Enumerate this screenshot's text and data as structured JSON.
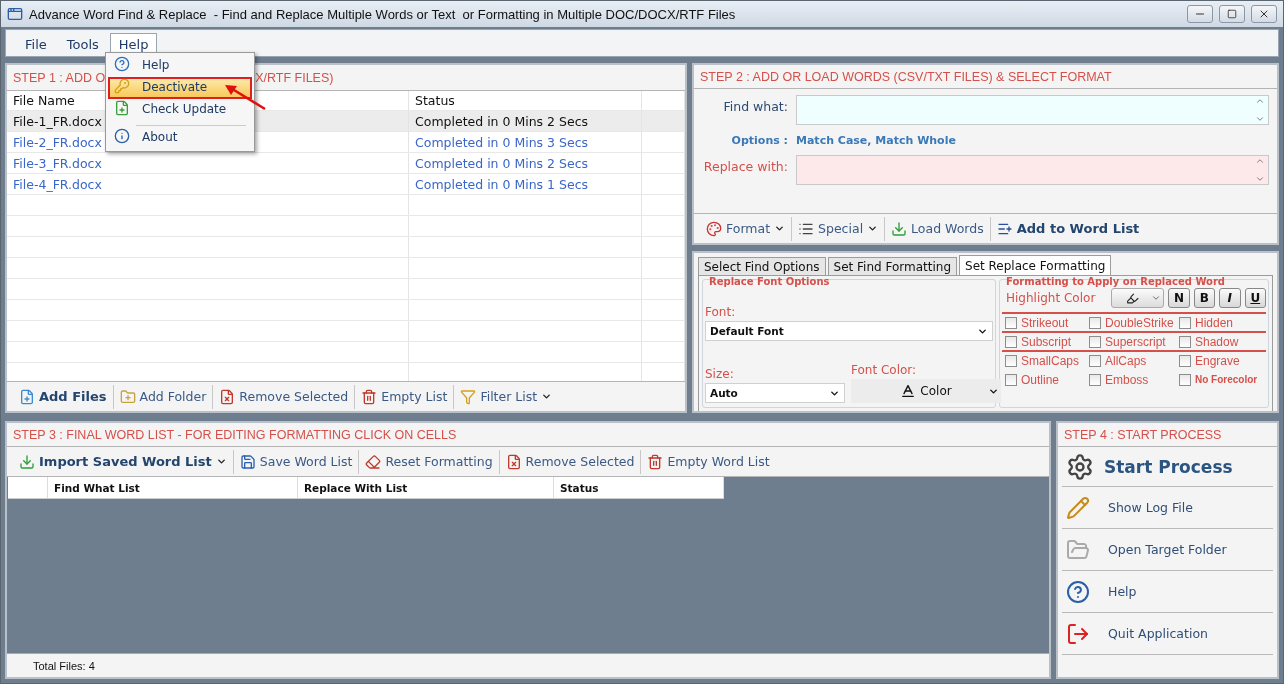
{
  "window": {
    "title": "Advance Word Find & Replace  - Find and Replace Multiple Words or Text  or Formatting in Multiple DOC/DOCX/RTF Files"
  },
  "menu_bar": [
    {
      "label": "File",
      "selected": false
    },
    {
      "label": "Tools",
      "selected": false
    },
    {
      "label": "Help",
      "selected": true
    }
  ],
  "open_menu": {
    "items": [
      {
        "label": "Help",
        "selected": false,
        "separator_before": false
      },
      {
        "label": "Deactivate",
        "selected": true,
        "separator_before": false
      },
      {
        "label": "Check Update",
        "selected": false,
        "separator_before": false
      },
      {
        "label": "About",
        "selected": false,
        "separator_before": true
      }
    ]
  },
  "step1": {
    "title_visible_parts": [
      "STEP 1 : ADD O",
      "X/RTF FILES)"
    ],
    "columns": [
      "File Name",
      "Status"
    ],
    "rows": [
      {
        "file": "File-1_FR.docx",
        "status": "Completed in 0 Mins 2 Secs",
        "selected": true
      },
      {
        "file": "File-2_FR.docx",
        "status": "Completed in 0 Mins 3 Secs",
        "selected": false
      },
      {
        "file": "File-3_FR.docx",
        "status": "Completed in 0 Mins 2 Secs",
        "selected": false
      },
      {
        "file": "File-4_FR.docx",
        "status": "Completed in 0 Mins 1 Secs",
        "selected": false
      }
    ],
    "toolbar": [
      {
        "label": "Add Files",
        "bold": true,
        "dropdown": false
      },
      {
        "label": "Add Folder",
        "bold": false,
        "dropdown": false
      },
      {
        "label": "Remove Selected",
        "bold": false,
        "dropdown": false
      },
      {
        "label": "Empty List",
        "bold": false,
        "dropdown": false
      },
      {
        "label": "Filter List",
        "bold": false,
        "dropdown": true
      }
    ]
  },
  "step2": {
    "title": "STEP 2 : ADD OR LOAD WORDS (CSV/TXT FILES) & SELECT FORMAT",
    "find_label": "Find what:",
    "options_label": "Options :",
    "options_value": "Match Case, Match Whole",
    "replace_label": "Replace with:",
    "toolbar": [
      {
        "label": "Format",
        "bold": false,
        "dropdown": true
      },
      {
        "label": "Special",
        "bold": false,
        "dropdown": true
      },
      {
        "label": "Load Words",
        "bold": false,
        "dropdown": false
      },
      {
        "label": "Add to Word List",
        "bold": true,
        "dropdown": false
      }
    ]
  },
  "format_tabs": {
    "tabs": [
      {
        "label": "Select Find Options",
        "selected": false
      },
      {
        "label": "Set Find Formatting",
        "selected": false
      },
      {
        "label": "Set Replace Formatting",
        "selected": true
      }
    ],
    "font_group": {
      "title": "Replace Font Options",
      "font_label": "Font:",
      "font_value": "Default Font",
      "size_label": "Size:",
      "size_value": "Auto",
      "color_label": "Font Color:",
      "color_button": "Color"
    },
    "style_group": {
      "title": "Formatting to Apply on Replaced Word",
      "highlight_label": "Highlight Color",
      "style_buttons": [
        {
          "label": "N",
          "kind": "normal"
        },
        {
          "label": "B",
          "kind": "bold"
        },
        {
          "label": "I",
          "kind": "italic"
        },
        {
          "label": "U",
          "kind": "underline"
        }
      ],
      "checkboxes": [
        {
          "label": "Strikeout",
          "checked": false,
          "bold": false
        },
        {
          "label": "DoubleStrike",
          "checked": false,
          "bold": false
        },
        {
          "label": "Hidden",
          "checked": false,
          "bold": false
        },
        {
          "label": "Subscript",
          "checked": false,
          "bold": false
        },
        {
          "label": "Superscript",
          "checked": false,
          "bold": false
        },
        {
          "label": "Shadow",
          "checked": false,
          "bold": false
        },
        {
          "label": "SmallCaps",
          "checked": false,
          "bold": false
        },
        {
          "label": "AllCaps",
          "checked": false,
          "bold": false
        },
        {
          "label": "Engrave",
          "checked": false,
          "bold": false
        },
        {
          "label": "Outline",
          "checked": false,
          "bold": false
        },
        {
          "label": "Emboss",
          "checked": false,
          "bold": false
        },
        {
          "label": "No Forecolor",
          "checked": false,
          "bold": true
        }
      ]
    }
  },
  "step3": {
    "title": "STEP 3 : FINAL WORD LIST - FOR EDITING FORMATTING CLICK ON CELLS",
    "toolbar": [
      {
        "label": "Import Saved Word List",
        "bold": true,
        "dropdown": true
      },
      {
        "label": "Save Word List",
        "bold": false,
        "dropdown": false
      },
      {
        "label": "Reset Formatting",
        "bold": false,
        "dropdown": false
      },
      {
        "label": "Remove Selected",
        "bold": false,
        "dropdown": false
      },
      {
        "label": "Empty Word List",
        "bold": false,
        "dropdown": false
      }
    ],
    "columns": [
      "Find What List",
      "Replace With List",
      "Status"
    ],
    "status_bar": "Total Files: 4"
  },
  "step4": {
    "title": "STEP 4 : START PROCESS",
    "actions": [
      {
        "label": "Start Process",
        "kind": "primary"
      },
      {
        "label": "Show Log File",
        "kind": "normal"
      },
      {
        "label": "Open Target Folder",
        "kind": "normal"
      },
      {
        "label": "Help",
        "kind": "normal"
      },
      {
        "label": "Quit Application",
        "kind": "normal"
      }
    ]
  }
}
